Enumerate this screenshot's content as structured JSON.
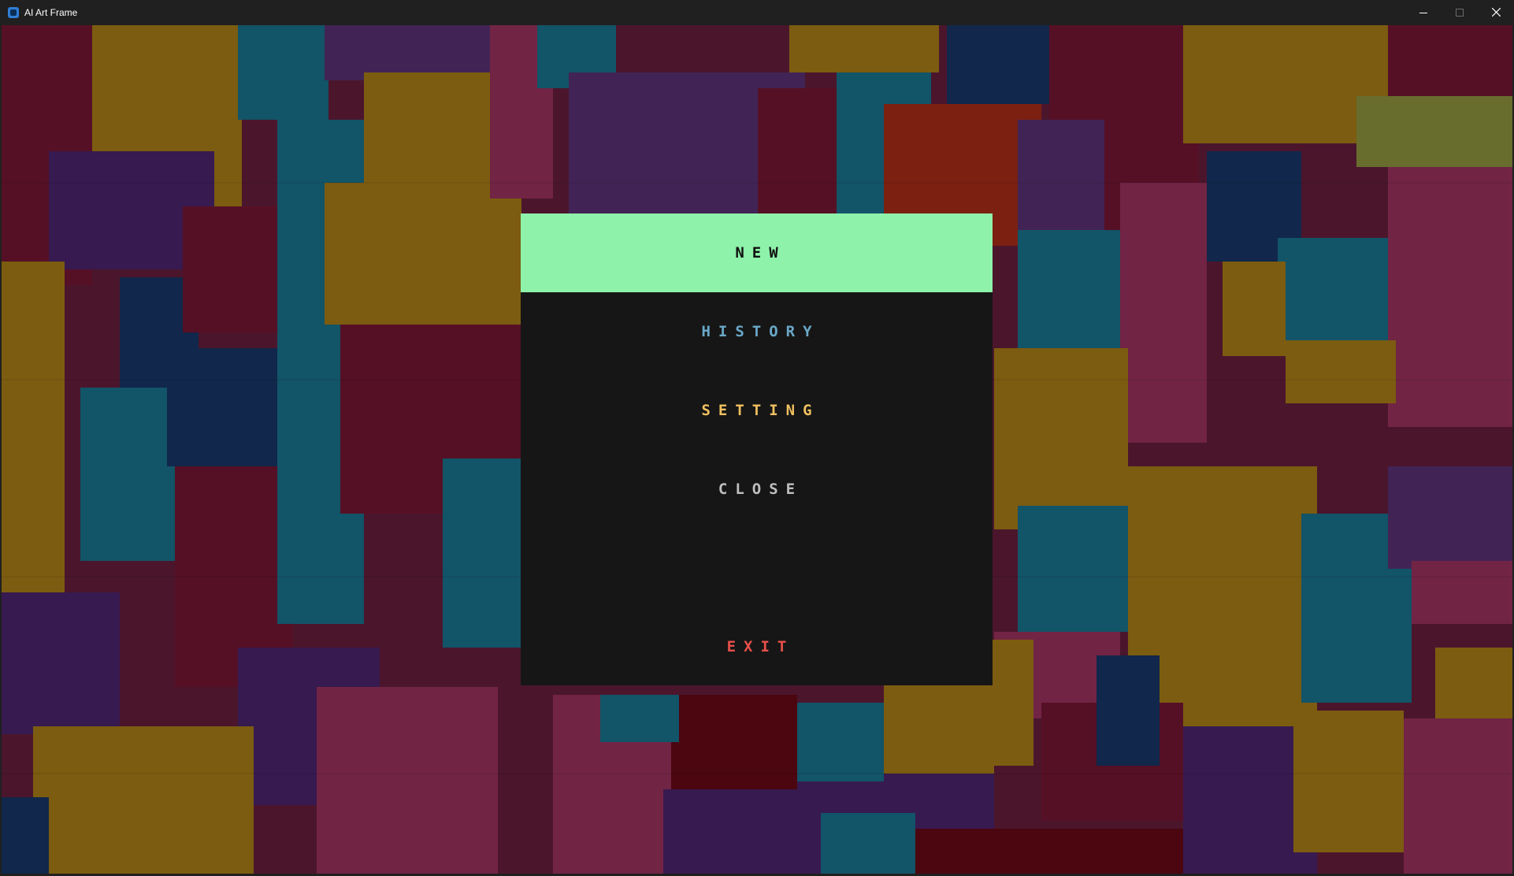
{
  "window": {
    "title": "AI Art Frame",
    "app_icon": "app-icon",
    "controls": [
      "minimize-icon",
      "maximize-icon",
      "close-icon"
    ]
  },
  "menu": {
    "items": [
      {
        "label": "NEW",
        "color": "#111111",
        "background": "#8ef2aa",
        "selected": true
      },
      {
        "label": "HISTORY",
        "color": "#6aa8c8"
      },
      {
        "label": "SETTING",
        "color": "#f0c060"
      },
      {
        "label": "CLOSE",
        "color": "#bfbfbf"
      },
      {
        "label": "EXIT",
        "color": "#e8504a"
      }
    ]
  },
  "colors": {
    "menu_background": "#161616",
    "art_palette": [
      "#c9951b",
      "#1e88a8",
      "#8c1a3d",
      "#1c3f7a",
      "#b83a6e",
      "#5a2a82",
      "#c8341e"
    ]
  }
}
